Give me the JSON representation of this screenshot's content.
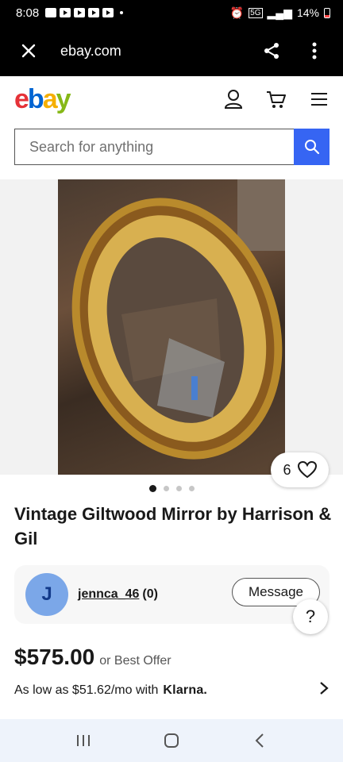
{
  "status_bar": {
    "time": "8:08",
    "battery": "14%",
    "network": "5G"
  },
  "browser": {
    "url": "ebay.com"
  },
  "header": {
    "logo_letters": [
      "e",
      "b",
      "a",
      "y"
    ],
    "logo_colors": [
      "#e53238",
      "#0064d2",
      "#f5af02",
      "#86b817"
    ]
  },
  "search": {
    "placeholder": "Search for anything",
    "accent": "#3665f3"
  },
  "listing": {
    "watch_count": "6",
    "gallery_dots": 4,
    "active_dot": 0,
    "title": "Vintage Giltwood Mirror by Harrison & Gil",
    "price": "$575.00",
    "offer_text": "or Best Offer",
    "financing_text": "As low as $51.62/mo with",
    "financing_brand": "Klarna."
  },
  "seller": {
    "initial": "J",
    "name": "jennca_46",
    "rating": "(0)",
    "message_label": "Message"
  },
  "help_label": "?"
}
